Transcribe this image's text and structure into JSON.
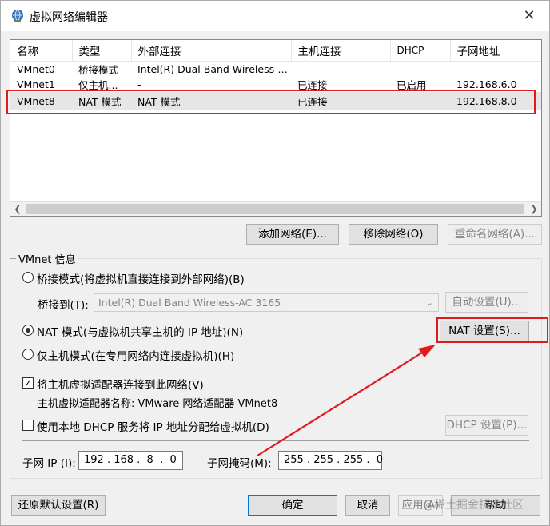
{
  "window": {
    "title": "虚拟网络编辑器"
  },
  "table": {
    "columns": [
      "名称",
      "类型",
      "外部连接",
      "主机连接",
      "DHCP",
      "子网地址"
    ],
    "rows": [
      [
        "VMnet0",
        "桥接模式",
        "Intel(R) Dual Band Wireless-A...",
        "-",
        "-",
        "-"
      ],
      [
        "VMnet1",
        "仅主机...",
        "-",
        "已连接",
        "已启用",
        "192.168.6.0"
      ],
      [
        "VMnet8",
        "NAT 模式",
        "NAT 模式",
        "已连接",
        "-",
        "192.168.8.0"
      ]
    ],
    "selected_row": "VMnet8"
  },
  "list_buttons": {
    "add": "添加网络(E)...",
    "remove": "移除网络(O)",
    "rename": "重命名网络(A)..."
  },
  "vmnet_info": {
    "group_label": "VMnet 信息",
    "bridged_radio": "桥接模式(将虚拟机直接连接到外部网络)(B)",
    "bridged_to_label": "桥接到(T):",
    "bridged_to_value": "Intel(R) Dual Band Wireless-AC 3165",
    "auto_settings": "自动设置(U)...",
    "nat_radio": "NAT 模式(与虚拟机共享主机的 IP 地址)(N)",
    "nat_settings": "NAT 设置(S)...",
    "hostonly_radio": "仅主机模式(在专用网络内连接虚拟机)(H)",
    "selected_mode": "nat",
    "connect_adapter": "将主机虚拟适配器连接到此网络(V)",
    "connect_adapter_checked": true,
    "adapter_name": "主机虚拟适配器名称: VMware 网络适配器 VMnet8",
    "use_dhcp": "使用本地 DHCP 服务将 IP 地址分配给虚拟机(D)",
    "use_dhcp_checked": false,
    "dhcp_settings": "DHCP 设置(P)...",
    "subnet_ip_label": "子网 IP (I):",
    "subnet_ip": "192 . 168 .  8  .  0",
    "subnet_mask_label": "子网掩码(M):",
    "subnet_mask": "255 . 255 . 255 .  0"
  },
  "footer": {
    "restore": "还原默认设置(R)",
    "ok": "确定",
    "cancel": "取消",
    "apply": "应用(A)",
    "help": "帮助"
  },
  "watermark": "@稀土掘金技术社区",
  "colors": {
    "annotation": "#e11b1b",
    "accent": "#0078d7",
    "selected_row": "#e6e6e6"
  },
  "icons": {
    "title": "globe-network-icon",
    "close": "close-icon"
  }
}
